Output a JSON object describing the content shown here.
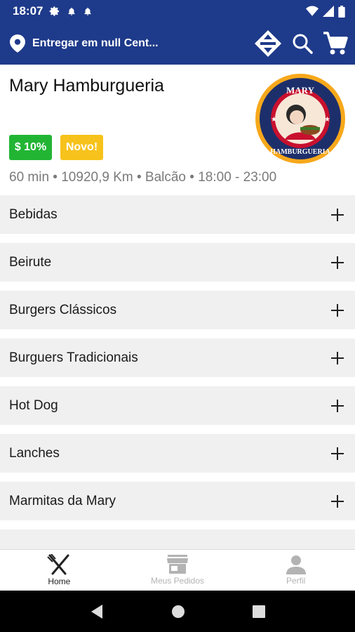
{
  "status_bar": {
    "time": "18:07"
  },
  "app_bar": {
    "location_text": "Entregar em null Cent...",
    "icons": [
      "location-pin-icon",
      "directions-icon",
      "search-icon",
      "cart-icon"
    ]
  },
  "store": {
    "name": "Mary Hamburgueria",
    "logo_text_top": "MARY",
    "logo_text_bottom": "HAMBURGUERIA",
    "badges": {
      "discount": "$ 10%",
      "new": "Novo!"
    },
    "info": "60 min • 10920,9 Km • Balcão • 18:00 - 23:00"
  },
  "categories": [
    {
      "label": "Bebidas"
    },
    {
      "label": "Beirute"
    },
    {
      "label": "Burgers Clássicos"
    },
    {
      "label": "Burguers Tradicionais"
    },
    {
      "label": "Hot Dog"
    },
    {
      "label": "Lanches"
    },
    {
      "label": "Marmitas da Mary"
    }
  ],
  "bottom_nav": {
    "home": "Home",
    "orders": "Meus Pedidos",
    "profile": "Perfil"
  },
  "colors": {
    "primary": "#1e3a8a",
    "discount": "#22b534",
    "new": "#f7c21b"
  }
}
